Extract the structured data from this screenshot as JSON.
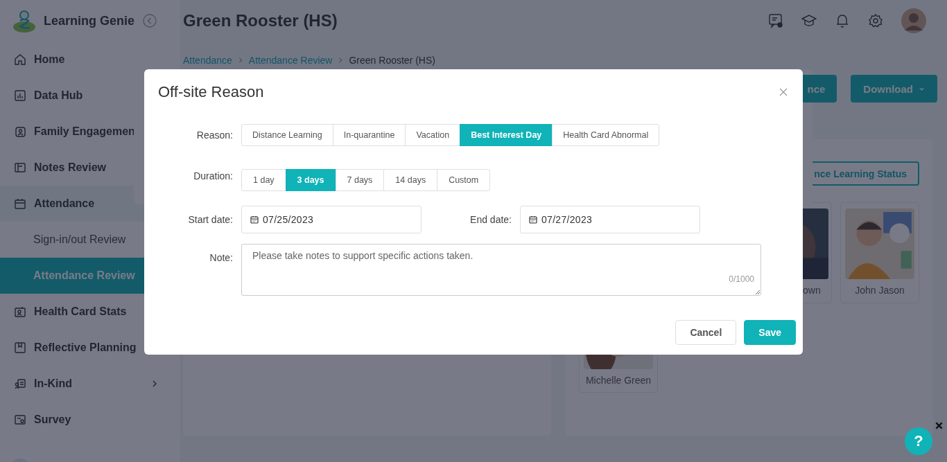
{
  "app": {
    "name": "Learning Genie"
  },
  "sidebar": {
    "items": [
      {
        "label": "Home",
        "selected": false
      },
      {
        "label": "Data Hub",
        "selected": false
      },
      {
        "label": "Family Engagemen",
        "selected": false
      },
      {
        "label": "Notes Review",
        "selected": false
      },
      {
        "label": "Attendance",
        "selected": false,
        "expanded": true,
        "children": [
          {
            "label": "Sign-in/out Review",
            "selected": false
          },
          {
            "label": "Attendance Review",
            "selected": true
          }
        ]
      },
      {
        "label": "Health Card Stats",
        "selected": false
      },
      {
        "label": "Reflective Planning",
        "selected": false
      },
      {
        "label": "In-Kind",
        "selected": false,
        "expanded": false
      },
      {
        "label": "Survey",
        "selected": false
      }
    ]
  },
  "header": {
    "title": "Green Rooster (HS)"
  },
  "breadcrumb": [
    {
      "label": "Attendance",
      "kind": "link"
    },
    {
      "label": "Attendance Review",
      "kind": "link"
    },
    {
      "label": "Green Rooster (HS)",
      "kind": "current"
    }
  ],
  "toolbar": [
    {
      "label": "nce",
      "dropdown": false
    },
    {
      "label": "Download",
      "dropdown": true
    }
  ],
  "status_button": {
    "label": "nce Learning Status"
  },
  "children": [
    {
      "name": "own"
    },
    {
      "name": "John Jason"
    },
    {
      "name": "Michelle Green"
    }
  ],
  "dialog": {
    "title": "Off-site Reason",
    "reason": {
      "label": "Reason:",
      "options": [
        {
          "label": "Distance Learning",
          "selected": false
        },
        {
          "label": "In-quarantine",
          "selected": false
        },
        {
          "label": "Vacation",
          "selected": false
        },
        {
          "label": "Best Interest Day",
          "selected": true
        },
        {
          "label": "Health Card Abnormal",
          "selected": false
        }
      ]
    },
    "duration": {
      "label": "Duration:",
      "options": [
        {
          "label": "1 day",
          "selected": false
        },
        {
          "label": "3 days",
          "selected": true
        },
        {
          "label": "7 days",
          "selected": false
        },
        {
          "label": "14 days",
          "selected": false
        },
        {
          "label": "Custom",
          "selected": false
        }
      ]
    },
    "start_date": {
      "label": "Start date:",
      "value": "07/25/2023"
    },
    "end_date": {
      "label": "End date:",
      "value": "07/27/2023"
    },
    "note": {
      "label": "Note:",
      "placeholder": "Please take notes to support specific actions taken.",
      "counter": "0/1000"
    },
    "buttons": [
      {
        "label": "Cancel",
        "kind": "secondary"
      },
      {
        "label": "Save",
        "kind": "primary"
      }
    ]
  },
  "help": {
    "label": "?"
  }
}
